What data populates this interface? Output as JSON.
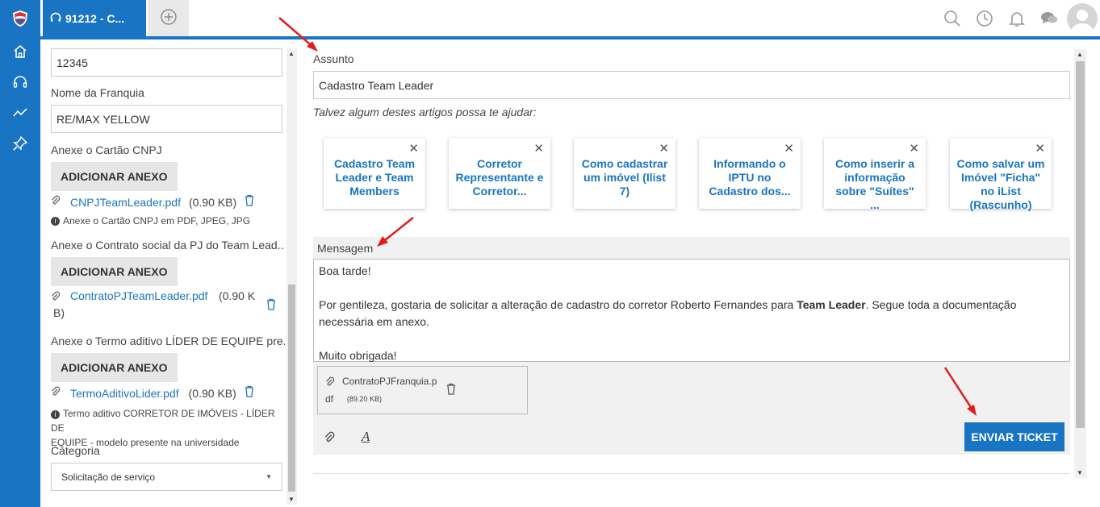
{
  "app": {
    "logo": "shield-logo-icon",
    "accent": "#1a74c4"
  },
  "sidebar": {
    "items": [
      {
        "icon": "home-icon"
      },
      {
        "icon": "headset-icon"
      },
      {
        "icon": "chart-line-icon"
      },
      {
        "icon": "pin-icon"
      }
    ]
  },
  "tabs": {
    "active_label": "91212 - C...",
    "active_icon": "headset-icon",
    "add_icon": "plus-circle-icon"
  },
  "topbar": {
    "icons": [
      "search-icon",
      "clock-icon",
      "bell-icon",
      "chat-icon"
    ]
  },
  "left": {
    "field_value": "12345",
    "franquia_label": "Nome da Franquia",
    "franquia_value": "RE/MAX YELLOW",
    "cnpj_label": "Anexe o Cartão CNPJ",
    "add_label": "ADICIONAR ANEXO",
    "cnpj_file": "CNPJTeamLeader.pdf",
    "cnpj_size": "(0.90 KB)",
    "cnpj_hint": "Anexe o Cartão CNPJ em PDF, JPEG, JPG",
    "contrato_label": "Anexe o Contrato social da PJ do Team Lead...",
    "contrato_file": "ContratoPJTeamLeader.pdf",
    "contrato_size_1": "(0.90 K",
    "contrato_size_2": "B)",
    "termo_label": "Anexe o Termo aditivo LÍDER DE EQUIPE pre...",
    "termo_file": "TermoAditivoLider.pdf",
    "termo_size": "(0.90 KB)",
    "termo_hint_1": "Termo aditivo CORRETOR DE IMÓVEIS - LÍDER DE",
    "termo_hint_2": "EQUIPE - modelo presente na universidade",
    "categoria_label": "Categoria",
    "categoria_value": "Solicitação de serviço"
  },
  "main": {
    "assunto_label": "Assunto",
    "assunto_value": "Cadastro Team Leader",
    "suggest_text": "Talvez algum destes artigos possa te ajudar:",
    "articles": [
      {
        "title": "Cadastro Team Leader e Team Members"
      },
      {
        "title": "Corretor Representante e Corretor..."
      },
      {
        "title": "Como cadastrar um imóvel (Ilist 7)"
      },
      {
        "title": "Informando o IPTU no Cadastro dos..."
      },
      {
        "title": "Como inserir a informação sobre \"Suítes\" ..."
      },
      {
        "title": "Como salvar um Imóvel \"Ficha\" no iList (Rascunho)"
      }
    ],
    "mensagem_label": "Mensagem",
    "msg_line1": "Boa tarde!",
    "msg_line2a": "Por gentileza, gostaria de solicitar a alteração de cadastro do corretor Roberto Fernandes para ",
    "msg_line2b": "Team Leader",
    "msg_line2c": ". Segue toda a documentação",
    "msg_line3": "necessária em anexo.",
    "msg_line4": "Muito obrigada!",
    "attach_name_1": "ContratoPJFranquia.p",
    "attach_name_2": "df",
    "attach_size": "(89.20 KB)",
    "send_label": "ENVIAR TICKET"
  }
}
